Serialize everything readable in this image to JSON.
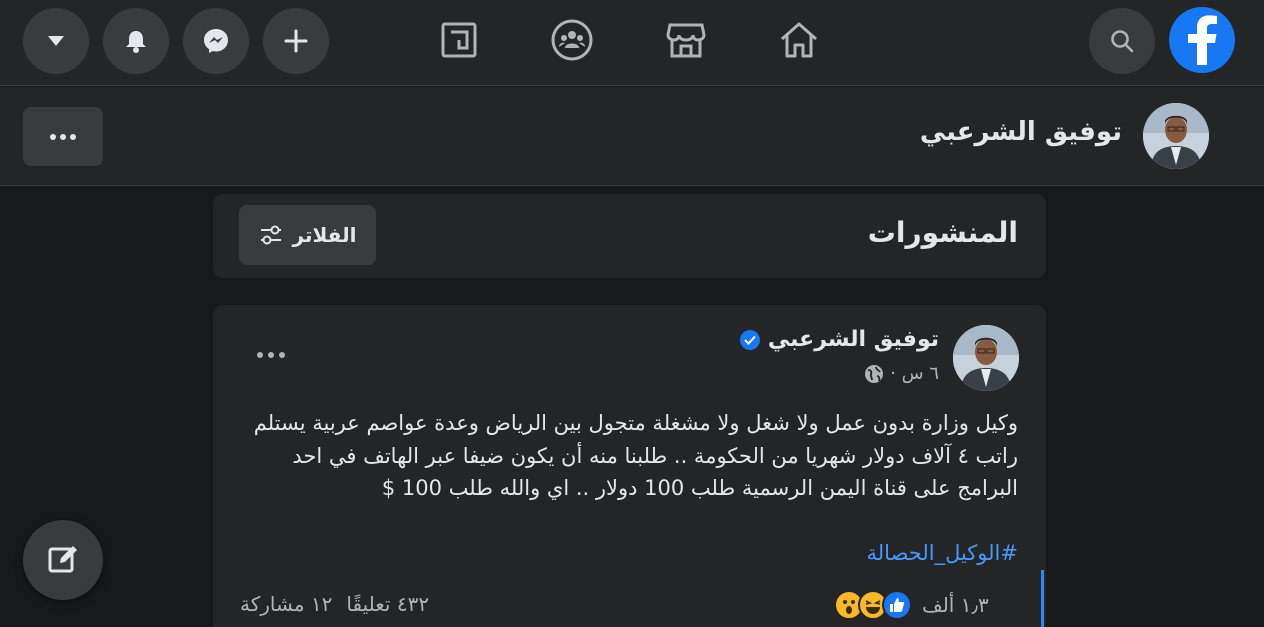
{
  "topbar": {
    "icons": [
      "account-menu-icon",
      "notifications-icon",
      "messenger-icon",
      "create-icon",
      "feeds-icon",
      "groups-icon",
      "marketplace-icon",
      "home-icon",
      "search-icon",
      "facebook-logo"
    ]
  },
  "profile": {
    "name": "توفيق الشرعبي"
  },
  "posts_header": {
    "title": "المنشورات",
    "filters_label": "الفلاتر"
  },
  "post": {
    "author": "توفيق الشرعبي",
    "time": "٦ س ·",
    "text": "وكيل وزارة بدون عمل ولا شغل ولا مشغلة متجول بين الرياض وعدة عواصم عربية يستلم راتب ٤ آلاف دولار شهريا من الحكومة .. طلبنا منه أن يكون ضيفا عبر الهاتف في احد البرامج على قناة اليمن الرسمية طلب 100 دولار .. اي والله طلب 100 $",
    "hashtag": "#الوكيل_الحصالة",
    "reactions_count": "١٫٣ ألف",
    "comments": "٤٣٢ تعليقًا",
    "shares": "١٢ مشاركة"
  },
  "colors": {
    "background": "#18191a",
    "surface": "#242526",
    "button": "#3a3b3c",
    "brand": "#1877f2",
    "link": "#4599ff"
  }
}
